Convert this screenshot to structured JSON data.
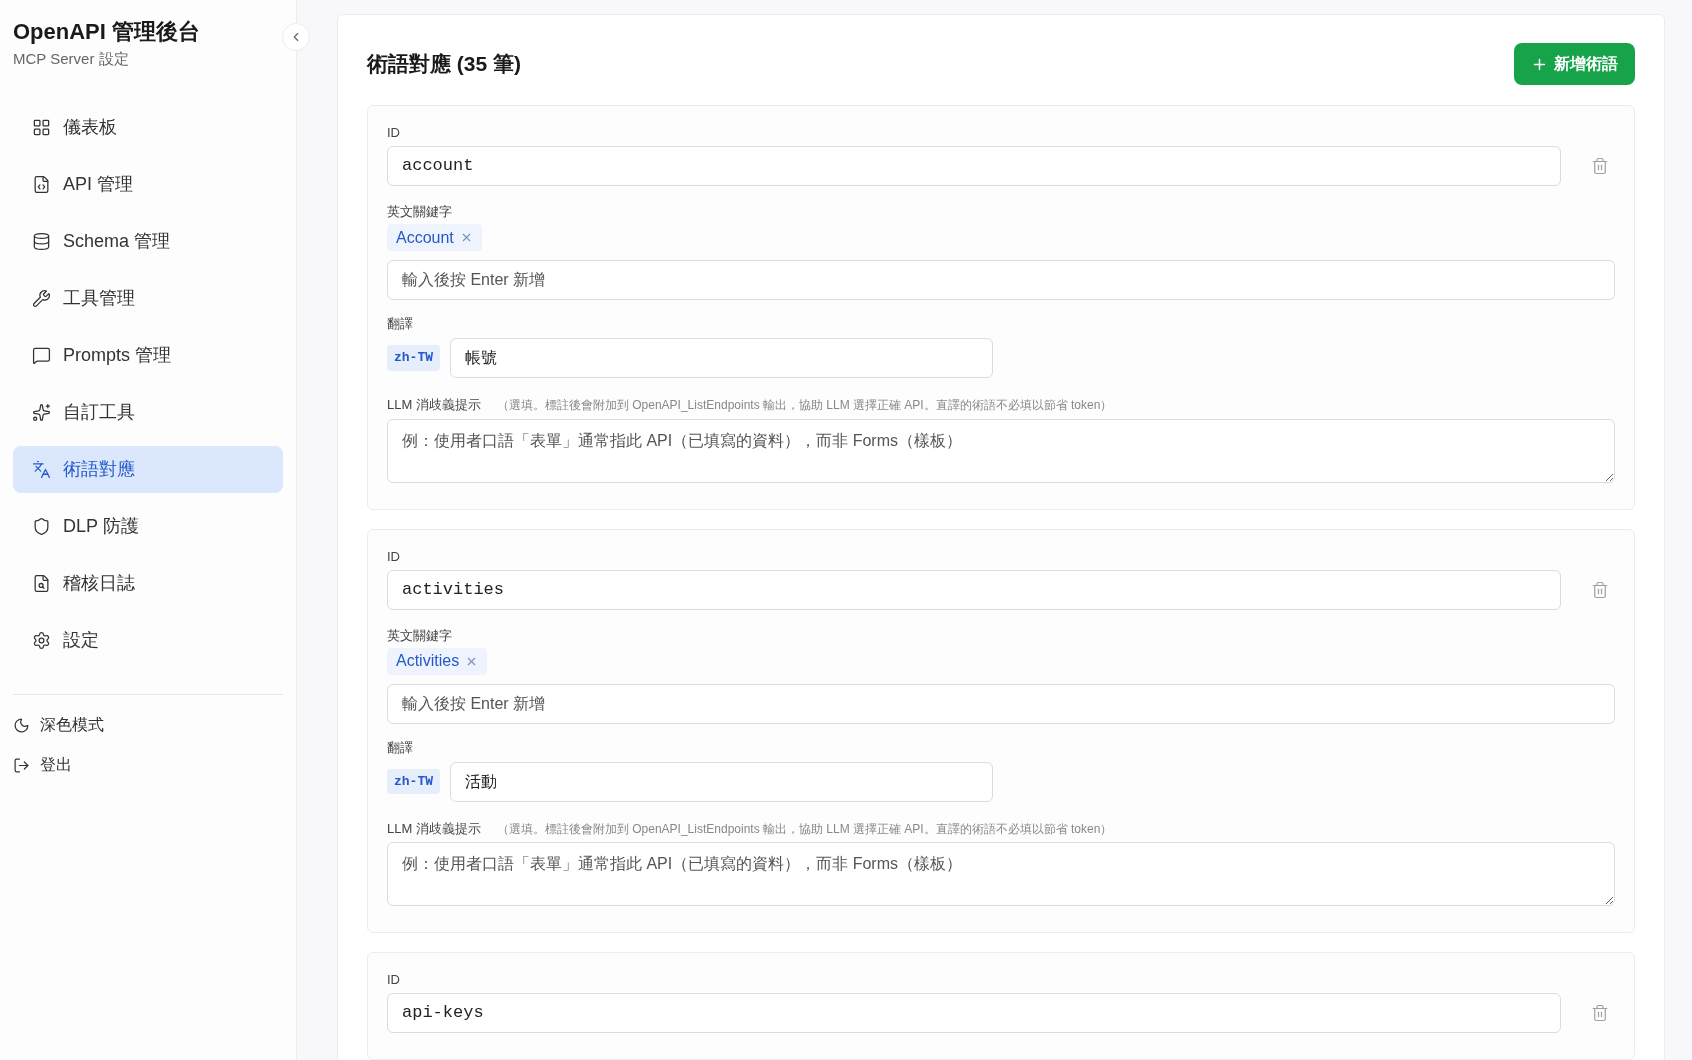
{
  "sidebar": {
    "title": "OpenAPI 管理後台",
    "subtitle": "MCP Server 設定",
    "items": [
      {
        "label": "儀表板",
        "selected": false
      },
      {
        "label": "API 管理",
        "selected": false
      },
      {
        "label": "Schema 管理",
        "selected": false
      },
      {
        "label": "工具管理",
        "selected": false
      },
      {
        "label": "Prompts 管理",
        "selected": false
      },
      {
        "label": "自訂工具",
        "selected": false
      },
      {
        "label": "術語對應",
        "selected": true
      },
      {
        "label": "DLP 防護",
        "selected": false
      },
      {
        "label": "稽核日誌",
        "selected": false
      },
      {
        "label": "設定",
        "selected": false
      }
    ],
    "footer": [
      {
        "kind": "theme",
        "label": "深色模式"
      },
      {
        "kind": "logout",
        "label": "登出"
      }
    ]
  },
  "page": {
    "title": "術語對應 (35 筆)",
    "add_button": "新增術語"
  },
  "terms": [
    {
      "id_label": "ID",
      "id": "account",
      "keywords_label": "英文關鍵字",
      "keywords": [
        "Account"
      ],
      "keyword_placeholder": "輸入後按 Enter 新增",
      "translations_label": "翻譯",
      "translations": [
        {
          "lang": "zh-TW",
          "value": "帳號"
        }
      ],
      "hint_label": "LLM 消歧義提示",
      "hint_note": "（選填。標註後會附加到 OpenAPI_ListEndpoints 輸出，協助 LLM 選擇正確 API。直譯的術語不必填以節省 token）",
      "hint_placeholder": "例：使用者口語「表單」通常指此 API（已填寫的資料），而非 Forms（樣板）"
    },
    {
      "id_label": "ID",
      "id": "activities",
      "keywords_label": "英文關鍵字",
      "keywords": [
        "Activities"
      ],
      "keyword_placeholder": "輸入後按 Enter 新增",
      "translations_label": "翻譯",
      "translations": [
        {
          "lang": "zh-TW",
          "value": "活動"
        }
      ],
      "hint_label": "LLM 消歧義提示",
      "hint_note": "（選填。標註後會附加到 OpenAPI_ListEndpoints 輸出，協助 LLM 選擇正確 API。直譯的術語不必填以節省 token）",
      "hint_placeholder": "例：使用者口語「表單」通常指此 API（已填寫的資料），而非 Forms（樣板）"
    },
    {
      "id_label": "ID",
      "id": "api-keys"
    }
  ]
}
